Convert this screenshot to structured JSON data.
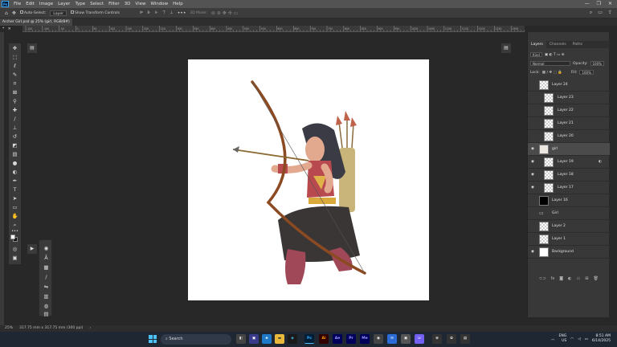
{
  "menu": {
    "items": [
      "File",
      "Edit",
      "Image",
      "Layer",
      "Type",
      "Select",
      "Filter",
      "3D",
      "View",
      "Window",
      "Help"
    ]
  },
  "options": {
    "auto_select": "Auto-Select:",
    "auto_select_target": "Layer",
    "transform_controls": "Show Transform Controls",
    "mode_3d": "3D Mode:"
  },
  "document": {
    "tab_title": "Archer Girl.psd @ 25% (girl, RGB/8#) *"
  },
  "ruler_ticks": [
    "-150",
    "-100",
    "-50",
    "0",
    "50",
    "100",
    "150",
    "200",
    "250",
    "300",
    "350",
    "400",
    "450",
    "500",
    "550",
    "600",
    "650",
    "700",
    "750",
    "800",
    "850",
    "900",
    "950",
    "1000",
    "1050",
    "1100",
    "1150",
    "1200",
    "1250",
    "1300"
  ],
  "panel": {
    "tabs": [
      "Layers",
      "Channels",
      "Paths"
    ],
    "kind_label": "Kind",
    "blend_mode": "Normal",
    "opacity_label": "Opacity:",
    "opacity_value": "100%",
    "lock_label": "Lock:",
    "fill_label": "Fill:",
    "fill_value": "100%",
    "layers": [
      {
        "name": "Layer 24",
        "thumb": "checker",
        "visible": false,
        "indent": false,
        "selected": false
      },
      {
        "name": "Layer 23",
        "thumb": "checker",
        "visible": false,
        "indent": true,
        "selected": false
      },
      {
        "name": "Layer 22",
        "thumb": "checker",
        "visible": false,
        "indent": true,
        "selected": false
      },
      {
        "name": "Layer 21",
        "thumb": "checker",
        "visible": false,
        "indent": true,
        "selected": false
      },
      {
        "name": "Layer 20",
        "thumb": "checker",
        "visible": false,
        "indent": true,
        "selected": false
      },
      {
        "name": "girl",
        "thumb": "pic",
        "visible": true,
        "indent": false,
        "selected": true
      },
      {
        "name": "Layer 19",
        "thumb": "checker",
        "visible": true,
        "indent": true,
        "selected": false,
        "fx": true
      },
      {
        "name": "Layer 18",
        "thumb": "checker",
        "visible": true,
        "indent": true,
        "selected": false
      },
      {
        "name": "Layer 17",
        "thumb": "checker",
        "visible": true,
        "indent": true,
        "selected": false
      },
      {
        "name": "Layer 16",
        "thumb": "black",
        "visible": false,
        "indent": false,
        "selected": false
      },
      {
        "name": "Girl",
        "thumb": "folder",
        "visible": false,
        "indent": false,
        "selected": false
      },
      {
        "name": "Layer 2",
        "thumb": "checker",
        "visible": false,
        "indent": false,
        "selected": false
      },
      {
        "name": "Layer 1",
        "thumb": "checker",
        "visible": false,
        "indent": false,
        "selected": false
      },
      {
        "name": "Background",
        "thumb": "white",
        "visible": true,
        "indent": false,
        "selected": false
      }
    ]
  },
  "status": {
    "zoom": "25%",
    "doc_size": "317.75 mm x 317.75 mm (300 ppi)"
  },
  "taskbar": {
    "search": "Search",
    "apps": [
      "Ps",
      "Ai",
      "Ae",
      "Pr",
      "Me"
    ],
    "lang": "ENG",
    "region": "US",
    "time": "8:51 AM",
    "date": "6/14/2025"
  },
  "colors": {
    "ps_blue": "#31a8ff",
    "canvas_bg": "#282828",
    "panel_bg": "#383838"
  }
}
